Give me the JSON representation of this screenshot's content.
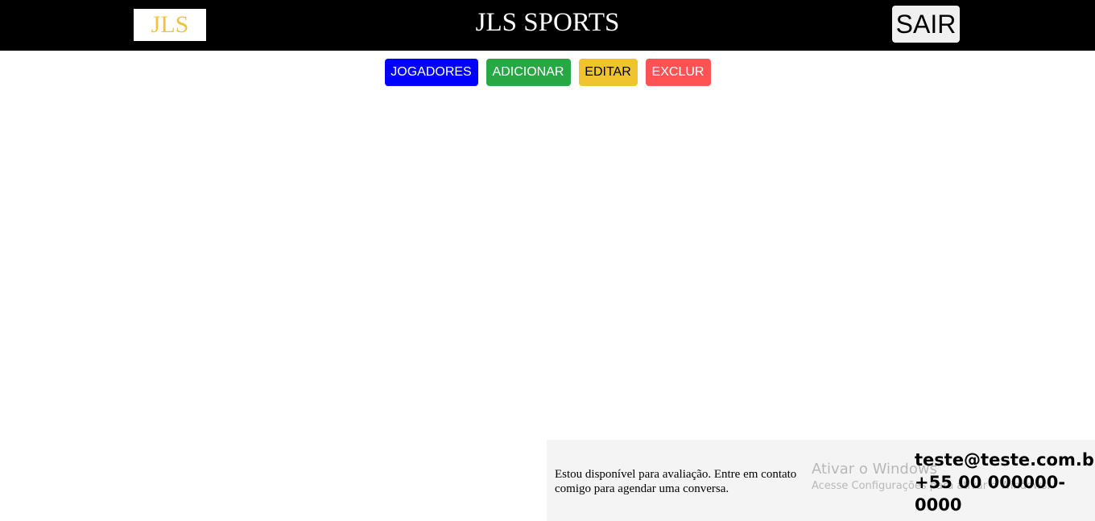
{
  "header": {
    "logo": "JLS",
    "brand": "JLS SPORTS",
    "logout_label": "SAIR"
  },
  "nav": {
    "players": "JOGADORES",
    "add": "ADICIONAR",
    "edit": "EDITAR",
    "delete": "EXCLUR"
  },
  "footer": {
    "message": "Estou disponível para avaliação. Entre em contato comigo para agendar uma conversa.",
    "email": "teste@teste.com.br",
    "phone": "+55 00 000000-0000"
  },
  "watermark": {
    "title": "Ativar o Windows",
    "subtitle": "Acesse Configurações para ativar o Windows."
  },
  "colors": {
    "header_bg": "#000000",
    "logo_text": "#f0c43a",
    "players_btn": "#0000ff",
    "add_btn": "#28a745",
    "edit_btn": "#f0c42e",
    "delete_btn": "#ff5252"
  }
}
